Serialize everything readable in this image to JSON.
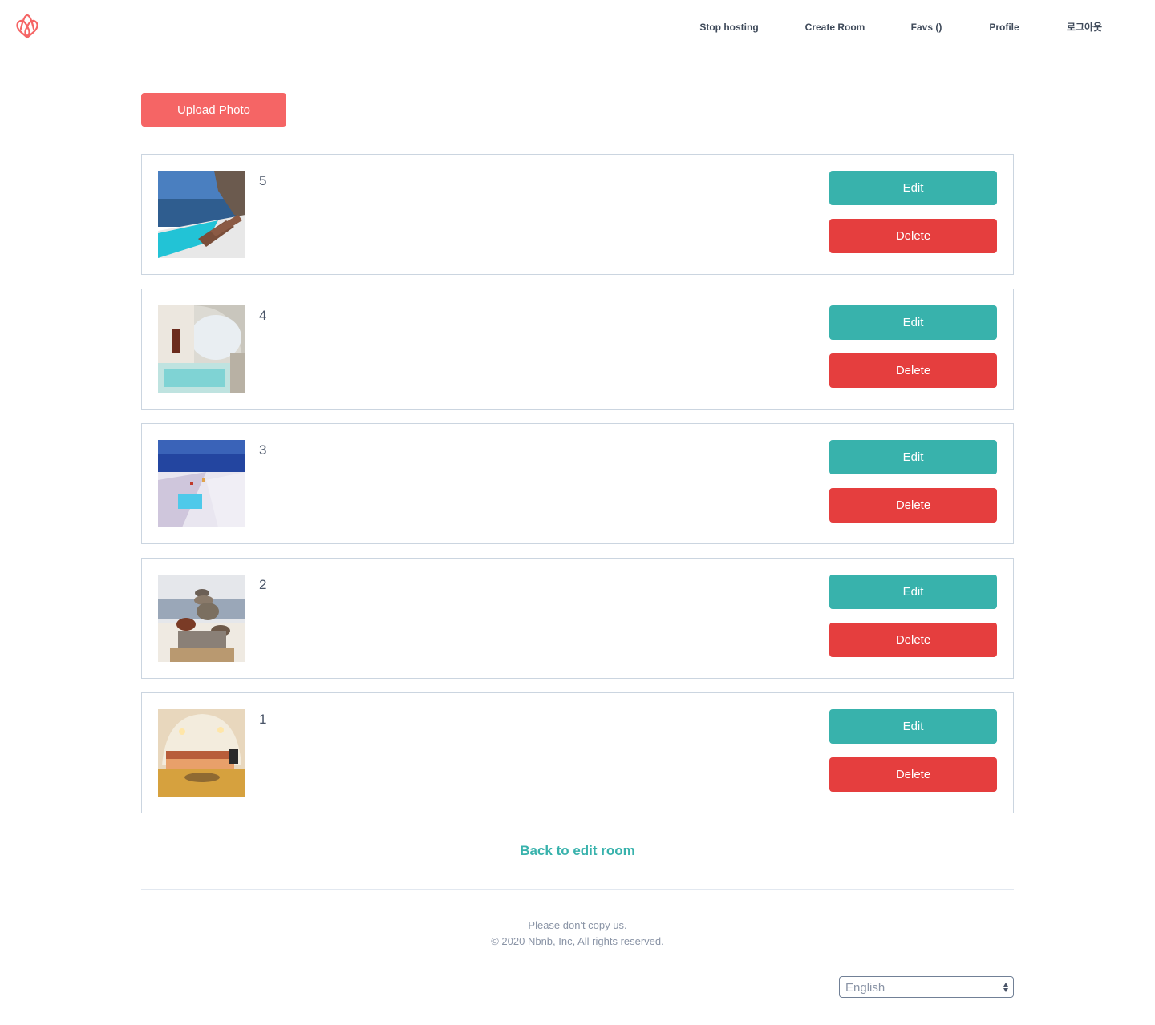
{
  "header": {
    "nav": {
      "stop_hosting": "Stop hosting",
      "create_room": "Create Room",
      "favs": "Favs ()",
      "profile": "Profile",
      "logout": "로그아웃"
    }
  },
  "upload_label": "Upload Photo",
  "photos": [
    {
      "caption": "5",
      "edit_label": "Edit",
      "delete_label": "Delete"
    },
    {
      "caption": "4",
      "edit_label": "Edit",
      "delete_label": "Delete"
    },
    {
      "caption": "3",
      "edit_label": "Edit",
      "delete_label": "Delete"
    },
    {
      "caption": "2",
      "edit_label": "Edit",
      "delete_label": "Delete"
    },
    {
      "caption": "1",
      "edit_label": "Edit",
      "delete_label": "Delete"
    }
  ],
  "back_link": "Back to edit room",
  "footer": {
    "line1": "Please don't copy us.",
    "line2": "© 2020 Nbnb, Inc, All rights reserved."
  },
  "language": {
    "selected": "English"
  },
  "colors": {
    "brand": "#f56565",
    "edit": "#38b2ac",
    "delete": "#e53e3e",
    "link": "#38b2ac"
  }
}
